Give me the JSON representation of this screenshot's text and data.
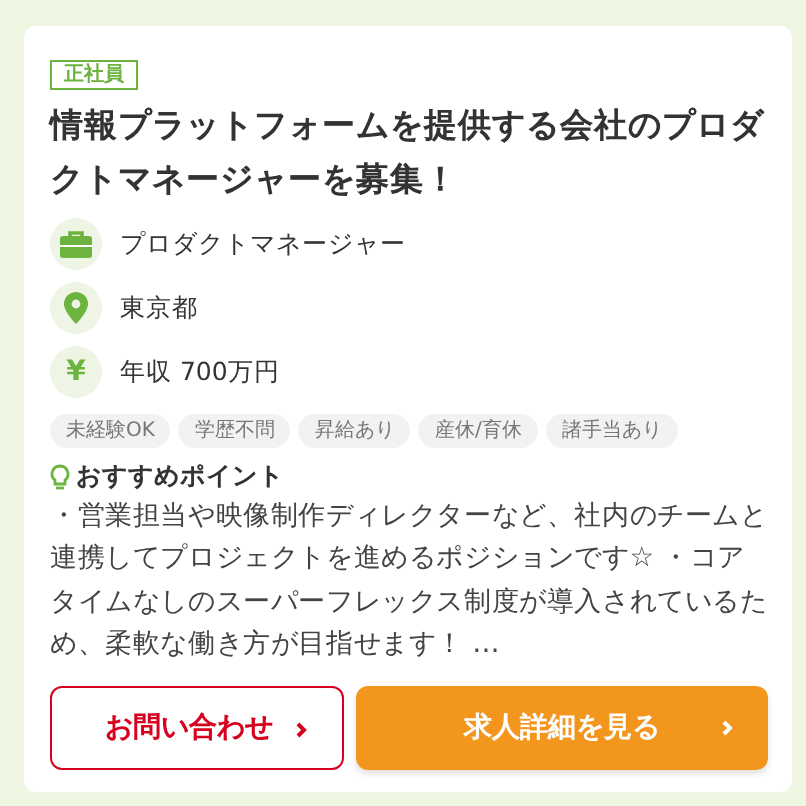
{
  "employment_badge": "正社員",
  "title": "情報プラットフォームを提供する会社のプロダクトマネージャーを募集！",
  "info": [
    {
      "kind": "job",
      "text": "プロダクトマネージャー"
    },
    {
      "kind": "location",
      "text": "東京都"
    },
    {
      "kind": "salary",
      "icon_text": "¥",
      "text": "年収 700万円"
    }
  ],
  "tags": [
    "未経験OK",
    "学歴不問",
    "昇給あり",
    "産休/育休",
    "諸手当あり"
  ],
  "recommend": {
    "heading": "おすすめポイント",
    "text": "・営業担当や映像制作ディレクターなど、社内のチームと連携してプロジェクトを進めるポジションです☆ ・コアタイムなしのスーパーフレックス制度が導入されているため、柔軟な働き方が目指せます！ …"
  },
  "buttons": [
    {
      "kind": "outline",
      "label": "お問い合わせ"
    },
    {
      "kind": "primary",
      "label": "求人詳細を見る"
    }
  ]
}
